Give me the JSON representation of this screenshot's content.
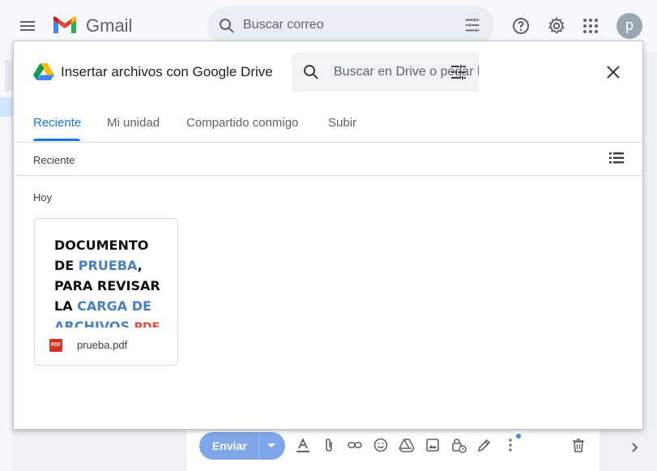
{
  "gmail": {
    "brand": "Gmail",
    "search_placeholder": "Buscar correo",
    "avatar_letter": "p"
  },
  "compose": {
    "send_label": "Enviar"
  },
  "picker": {
    "title": "Insertar archivos con Google Drive",
    "search_placeholder": "Buscar en Drive o pegar la …",
    "tabs": [
      {
        "label": "Reciente",
        "active": true
      },
      {
        "label": "Mi unidad",
        "active": false
      },
      {
        "label": "Compartido conmigo",
        "active": false
      },
      {
        "label": "Subir",
        "active": false
      }
    ],
    "breadcrumb": "Reciente",
    "section_label": "Hoy",
    "files": [
      {
        "name": "prueba.pdf",
        "type_badge": "PDF",
        "thumbnail_lines": [
          "DOCUMENTO",
          "DE PRUEBA,",
          "PARA REVISAR",
          "LA CARGA DE",
          "ARCHIVOS PDF"
        ]
      }
    ]
  },
  "colors": {
    "accent": "#1a73e8",
    "send_button": "#7fa6e8",
    "pdf_red": "#d93025"
  }
}
